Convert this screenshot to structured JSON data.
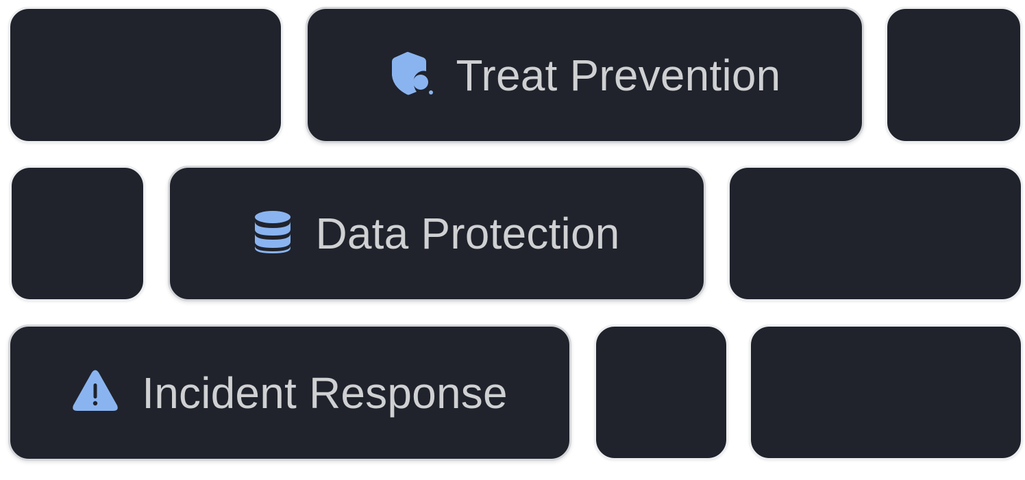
{
  "theme": {
    "tile_background": "#20232c",
    "label_color": "#cfd0d2",
    "icon_color": "#8ab4f0",
    "page_background": "#ffffff"
  },
  "features": [
    {
      "label": "Treat Prevention",
      "icon": "shield-search-icon"
    },
    {
      "label": "Data Protection",
      "icon": "database-icon"
    },
    {
      "label": "Incident Response",
      "icon": "warning-triangle-icon"
    }
  ]
}
